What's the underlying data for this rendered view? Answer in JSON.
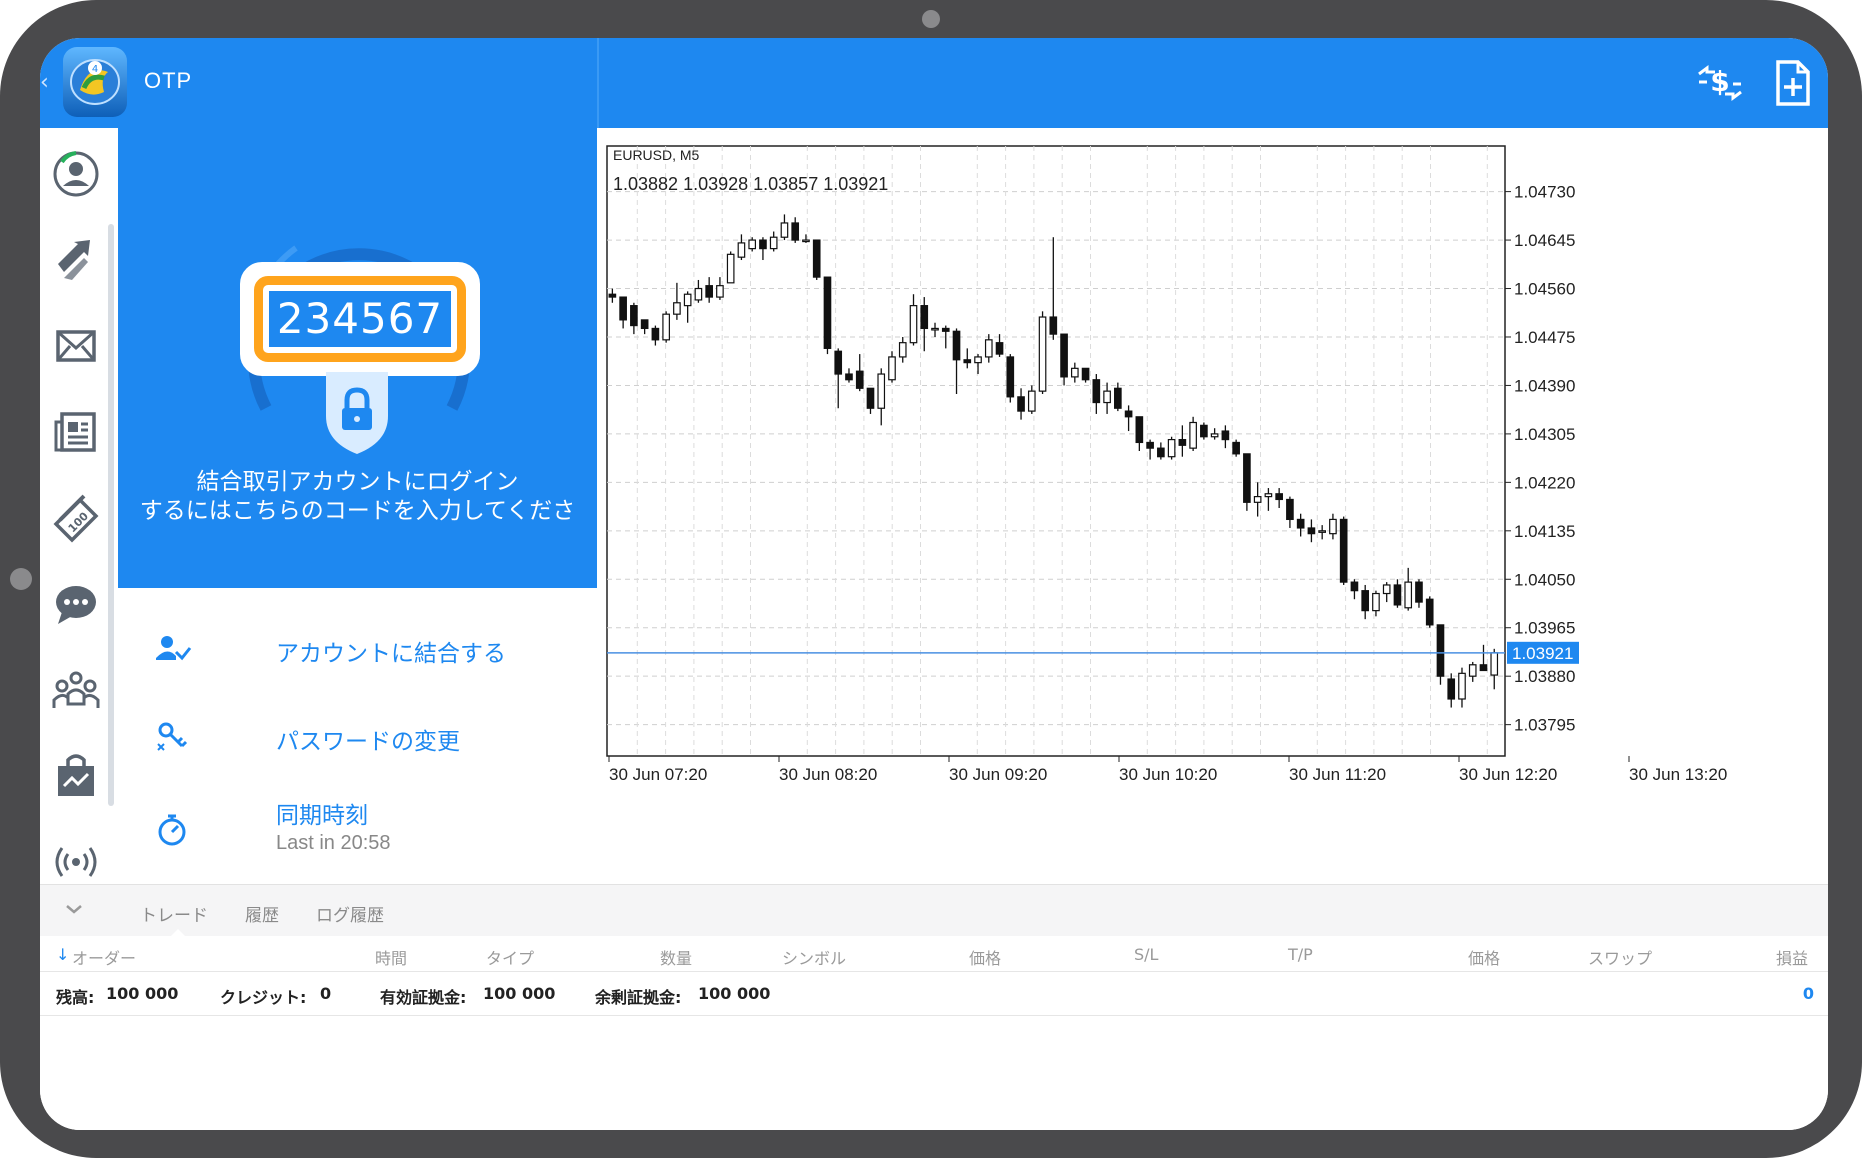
{
  "app": {
    "title": "OTP"
  },
  "toolbar": {
    "icons": [
      "currency-exchange-icon",
      "new-document-icon"
    ]
  },
  "rail": {
    "icons": [
      "account-icon",
      "trade-icon",
      "mail-icon",
      "news-icon",
      "calendar-icon",
      "chat-icon",
      "community-icon",
      "market-icon",
      "signal-icon"
    ]
  },
  "otp_panel": {
    "code": "234567",
    "message_line1": "結合取引アカウントにログイン",
    "message_line2": "するにはこちらのコードを入力してくださ"
  },
  "menu": {
    "bind_account": "アカウントに結合する",
    "change_password": "パスワードの変更",
    "sync_time": "同期時刻",
    "sync_time_sub": "Last in 20:58"
  },
  "chart": {
    "symbol_label": "EURUSD, M5",
    "ohlc_label": "1.03882 1.03928 1.03857 1.03921",
    "current_price_label": "1.03921"
  },
  "chart_data": {
    "type": "candlestick",
    "symbol": "EURUSD",
    "timeframe": "M5",
    "ylim": [
      1.0374,
      1.0481
    ],
    "y_ticks": [
      "1.04730",
      "1.04645",
      "1.04560",
      "1.04475",
      "1.04390",
      "1.04305",
      "1.04220",
      "1.04135",
      "1.04050",
      "1.03965",
      "1.03880",
      "1.03795"
    ],
    "x_ticks": [
      "30 Jun 07:20",
      "30 Jun 08:20",
      "30 Jun 09:20",
      "30 Jun 10:20",
      "30 Jun 11:20",
      "30 Jun 12:20",
      "30 Jun 13:20"
    ],
    "current_price": 1.03921,
    "grid": true,
    "candles": [
      [
        1.0455,
        1.0456,
        1.04535,
        1.04545
      ],
      [
        1.04545,
        1.04545,
        1.0449,
        1.04505
      ],
      [
        1.0453,
        1.04535,
        1.0448,
        1.04495
      ],
      [
        1.04505,
        1.04505,
        1.0448,
        1.0449
      ],
      [
        1.0449,
        1.04495,
        1.0446,
        1.0447
      ],
      [
        1.0447,
        1.0452,
        1.04465,
        1.04515
      ],
      [
        1.04515,
        1.0457,
        1.04505,
        1.04535
      ],
      [
        1.0453,
        1.04555,
        1.045,
        1.0455
      ],
      [
        1.0454,
        1.04575,
        1.04535,
        1.0456
      ],
      [
        1.04565,
        1.0458,
        1.04535,
        1.04545
      ],
      [
        1.04545,
        1.0458,
        1.0454,
        1.04565
      ],
      [
        1.0457,
        1.04625,
        1.0457,
        1.0462
      ],
      [
        1.04615,
        1.04655,
        1.0461,
        1.0464
      ],
      [
        1.0463,
        1.0465,
        1.04625,
        1.04645
      ],
      [
        1.04645,
        1.0465,
        1.0461,
        1.0463
      ],
      [
        1.0463,
        1.0466,
        1.04625,
        1.0465
      ],
      [
        1.0465,
        1.0469,
        1.04645,
        1.04675
      ],
      [
        1.04675,
        1.04685,
        1.0464,
        1.04645
      ],
      [
        1.04645,
        1.04655,
        1.0464,
        1.04645
      ],
      [
        1.04645,
        1.04645,
        1.04575,
        1.0458
      ],
      [
        1.0458,
        1.0458,
        1.04445,
        1.04455
      ],
      [
        1.0445,
        1.04455,
        1.0435,
        1.0441
      ],
      [
        1.0441,
        1.0442,
        1.04395,
        1.044
      ],
      [
        1.04415,
        1.04445,
        1.0438,
        1.04385
      ],
      [
        1.04385,
        1.04385,
        1.0434,
        1.0435
      ],
      [
        1.0435,
        1.0442,
        1.0432,
        1.0441
      ],
      [
        1.044,
        1.0445,
        1.04395,
        1.0444
      ],
      [
        1.0444,
        1.04475,
        1.0443,
        1.04465
      ],
      [
        1.04465,
        1.0455,
        1.0446,
        1.0453
      ],
      [
        1.0453,
        1.04545,
        1.0445,
        1.0449
      ],
      [
        1.0449,
        1.045,
        1.04475,
        1.0449
      ],
      [
        1.0449,
        1.04495,
        1.04455,
        1.04485
      ],
      [
        1.04485,
        1.0449,
        1.04375,
        1.04435
      ],
      [
        1.04435,
        1.04455,
        1.0442,
        1.0443
      ],
      [
        1.0443,
        1.04445,
        1.0441,
        1.0444
      ],
      [
        1.0444,
        1.0448,
        1.0443,
        1.0447
      ],
      [
        1.04465,
        1.0448,
        1.0444,
        1.04445
      ],
      [
        1.0444,
        1.04445,
        1.0436,
        1.0437
      ],
      [
        1.0437,
        1.04385,
        1.0433,
        1.04345
      ],
      [
        1.04345,
        1.0439,
        1.0434,
        1.0438
      ],
      [
        1.0438,
        1.0452,
        1.04375,
        1.0451
      ],
      [
        1.0451,
        1.0465,
        1.0447,
        1.0448
      ],
      [
        1.0448,
        1.0448,
        1.0439,
        1.04405
      ],
      [
        1.04405,
        1.0443,
        1.04395,
        1.0442
      ],
      [
        1.0442,
        1.0442,
        1.04395,
        1.044
      ],
      [
        1.044,
        1.0441,
        1.0434,
        1.0436
      ],
      [
        1.0436,
        1.04395,
        1.0434,
        1.0438
      ],
      [
        1.04385,
        1.04395,
        1.04345,
        1.0435
      ],
      [
        1.04345,
        1.04355,
        1.0431,
        1.04335
      ],
      [
        1.04335,
        1.04335,
        1.04275,
        1.0429
      ],
      [
        1.0429,
        1.04295,
        1.0426,
        1.0428
      ],
      [
        1.0428,
        1.0429,
        1.0426,
        1.04265
      ],
      [
        1.04265,
        1.043,
        1.0426,
        1.04295
      ],
      [
        1.04295,
        1.0432,
        1.04265,
        1.04285
      ],
      [
        1.0428,
        1.04335,
        1.04275,
        1.04325
      ],
      [
        1.0432,
        1.04325,
        1.04295,
        1.043
      ],
      [
        1.043,
        1.04315,
        1.04295,
        1.04305
      ],
      [
        1.0431,
        1.0432,
        1.0428,
        1.04295
      ],
      [
        1.0429,
        1.04295,
        1.04265,
        1.0427
      ],
      [
        1.0427,
        1.0427,
        1.0417,
        1.04185
      ],
      [
        1.04185,
        1.0422,
        1.0416,
        1.04195
      ],
      [
        1.04195,
        1.0421,
        1.0417,
        1.042
      ],
      [
        1.042,
        1.0421,
        1.04175,
        1.0419
      ],
      [
        1.0419,
        1.04195,
        1.0414,
        1.04155
      ],
      [
        1.04155,
        1.04165,
        1.04125,
        1.0414
      ],
      [
        1.0414,
        1.04155,
        1.04115,
        1.0413
      ],
      [
        1.04135,
        1.04145,
        1.0412,
        1.04135
      ],
      [
        1.0413,
        1.04165,
        1.0412,
        1.04155
      ],
      [
        1.04155,
        1.0416,
        1.0404,
        1.04045
      ],
      [
        1.04045,
        1.0405,
        1.04015,
        1.0403
      ],
      [
        1.0403,
        1.0404,
        1.0398,
        1.03995
      ],
      [
        1.03995,
        1.0403,
        1.03985,
        1.04025
      ],
      [
        1.04025,
        1.04045,
        1.0401,
        1.0404
      ],
      [
        1.0404,
        1.0405,
        1.04,
        1.04005
      ],
      [
        1.04,
        1.0407,
        1.03995,
        1.04045
      ],
      [
        1.04045,
        1.0405,
        1.04,
        1.0401
      ],
      [
        1.04015,
        1.0402,
        1.03965,
        1.0397
      ],
      [
        1.0397,
        1.0397,
        1.03865,
        1.0388
      ],
      [
        1.03875,
        1.03885,
        1.03825,
        1.0384
      ],
      [
        1.0384,
        1.03895,
        1.03825,
        1.03885
      ],
      [
        1.0388,
        1.03905,
        1.0387,
        1.039
      ],
      [
        1.039,
        1.03935,
        1.0389,
        1.0389
      ],
      [
        1.03882,
        1.03928,
        1.03857,
        1.03921
      ]
    ]
  },
  "bottom": {
    "tabs": [
      "トレード",
      "履歴",
      "ログ履歴"
    ],
    "columns": [
      "オーダー",
      "時間",
      "タイプ",
      "数量",
      "シンボル",
      "価格",
      "S/L",
      "T/P",
      "価格",
      "スワップ",
      "損益"
    ],
    "summary": {
      "balance_label": "残高:",
      "balance_value": "100 000",
      "credit_label": "クレジット:",
      "credit_value": "0",
      "equity_label": "有効証拠金:",
      "equity_value": "100 000",
      "free_margin_label": "余剰証拠金:",
      "free_margin_value": "100 000",
      "profit_total": "0"
    }
  },
  "colors": {
    "brand": "#1e88f0",
    "accent_orange": "#ffa41c",
    "bezel": "#4a4a4c",
    "current_price_line": "#4a90e2"
  }
}
